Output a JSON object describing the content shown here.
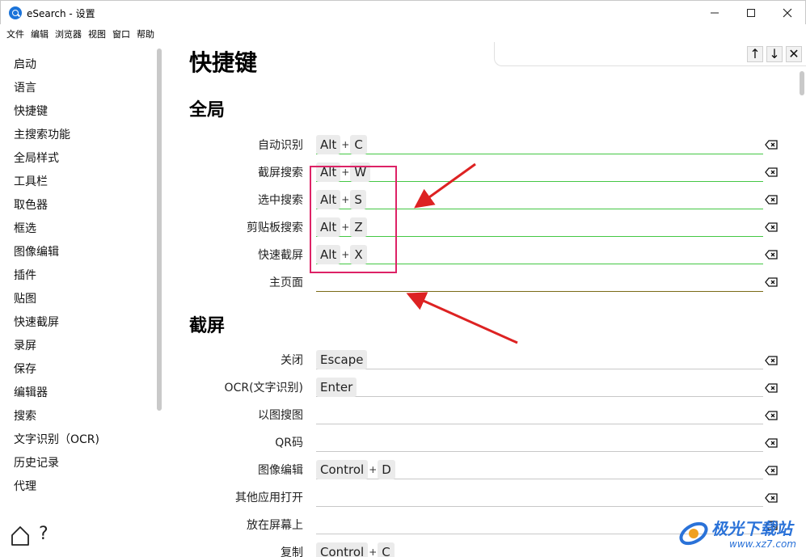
{
  "window": {
    "title": "eSearch - 设置"
  },
  "menu": [
    "文件",
    "编辑",
    "浏览器",
    "视图",
    "窗口",
    "帮助"
  ],
  "sidebar": {
    "items": [
      "启动",
      "语言",
      "快捷键",
      "主搜索功能",
      "全局样式",
      "工具栏",
      "取色器",
      "框选",
      "图像编辑",
      "插件",
      "贴图",
      "快速截屏",
      "录屏",
      "保存",
      "编辑器",
      "搜索",
      "文字识别（OCR)",
      "历史记录",
      "代理"
    ],
    "help_glyph": "?"
  },
  "page": {
    "title": "快捷键"
  },
  "find": {
    "up": "↑",
    "down": "↓",
    "close": "✕"
  },
  "sections": [
    {
      "title": "全局",
      "rows": [
        {
          "label": "自动识别",
          "keys": [
            "Alt",
            "C"
          ]
        },
        {
          "label": "截屏搜索",
          "keys": [
            "Alt",
            "W"
          ]
        },
        {
          "label": "选中搜索",
          "keys": [
            "Alt",
            "S"
          ]
        },
        {
          "label": "剪贴板搜索",
          "keys": [
            "Alt",
            "Z"
          ]
        },
        {
          "label": "快速截屏",
          "keys": [
            "Alt",
            "X"
          ]
        },
        {
          "label": "主页面",
          "keys": []
        }
      ]
    },
    {
      "title": "截屏",
      "rows": [
        {
          "label": "关闭",
          "keys": [
            "Escape"
          ]
        },
        {
          "label": "OCR(文字识别)",
          "keys": [
            "Enter"
          ]
        },
        {
          "label": "以图搜图",
          "keys": []
        },
        {
          "label": "QR码",
          "keys": []
        },
        {
          "label": "图像编辑",
          "keys": [
            "Control",
            "D"
          ]
        },
        {
          "label": "其他应用打开",
          "keys": []
        },
        {
          "label": "放在屏幕上",
          "keys": []
        },
        {
          "label": "复制",
          "keys": [
            "Control",
            "C"
          ]
        }
      ]
    }
  ],
  "plus_glyph": "+",
  "watermark": {
    "text": "极光下载站",
    "url": "www.xz7.com"
  },
  "colors": {
    "annotation": "#dd2266",
    "arrow": "#dd2222",
    "active_underline": "#44c744"
  }
}
